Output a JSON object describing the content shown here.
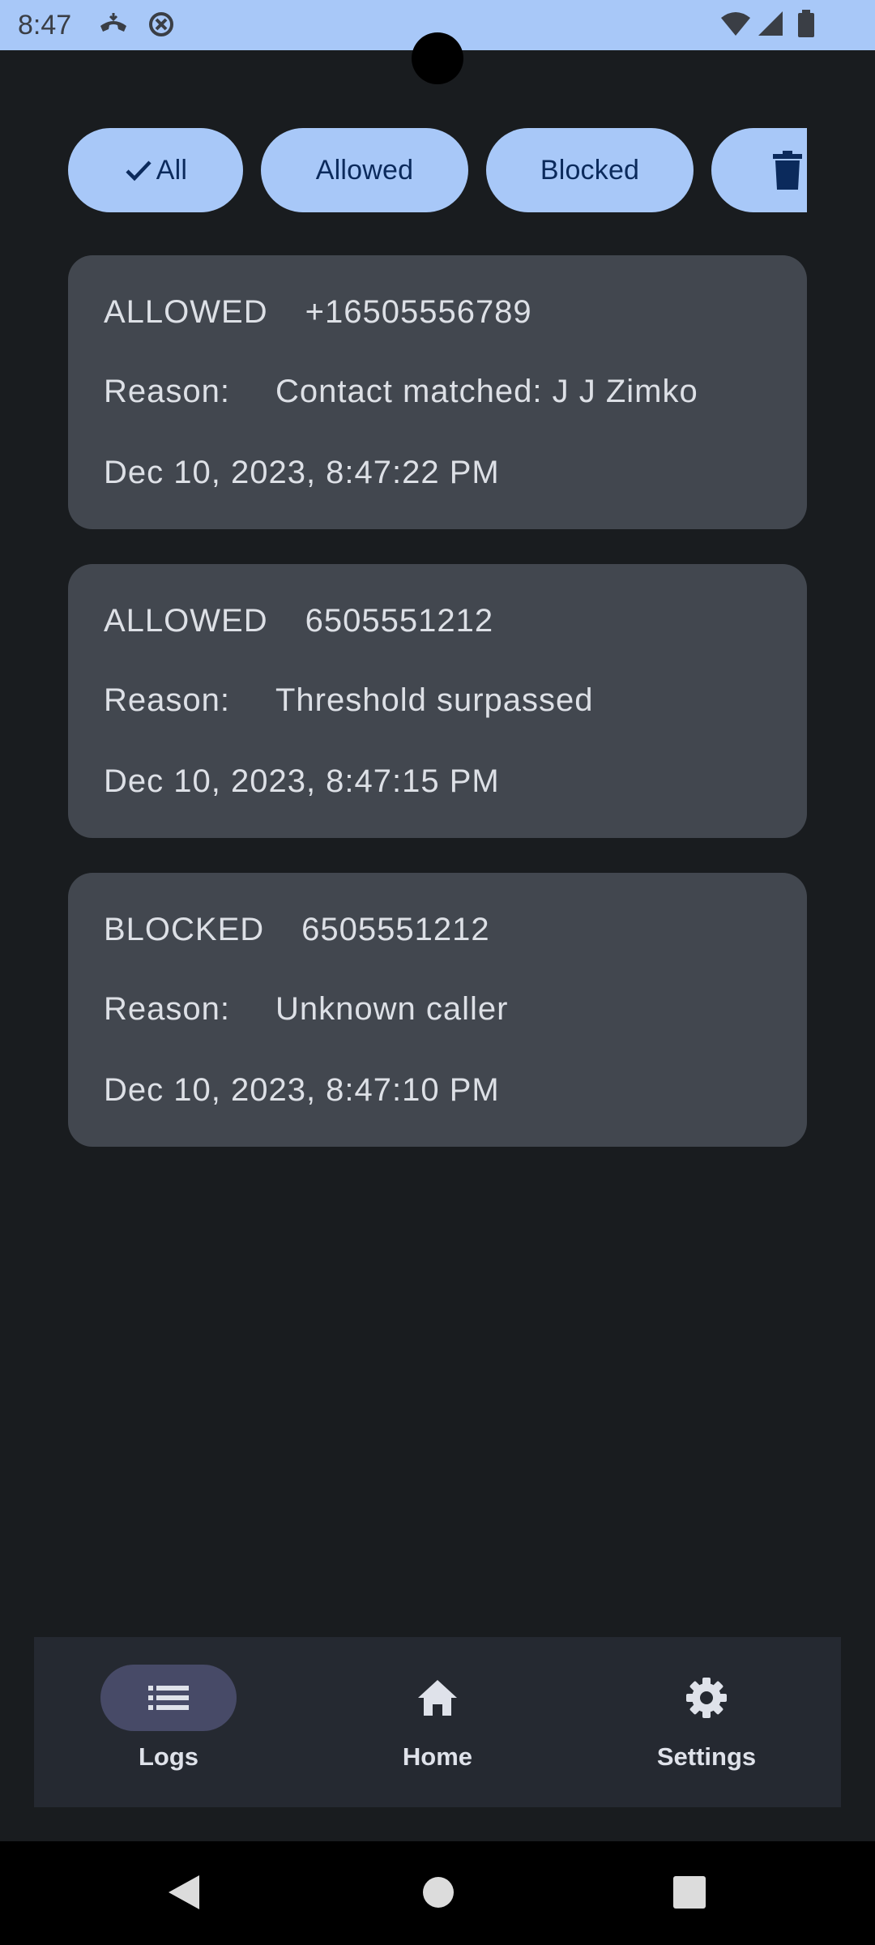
{
  "status_bar": {
    "time": "8:47"
  },
  "filters": [
    {
      "label": "All",
      "selected": true
    },
    {
      "label": "Allowed",
      "selected": false
    },
    {
      "label": "Blocked",
      "selected": false
    }
  ],
  "logs": [
    {
      "status": "ALLOWED",
      "number": "+16505556789",
      "reason_label": "Reason:",
      "reason": "Contact matched: J J Zimko",
      "timestamp": "Dec 10, 2023, 8:47:22 PM"
    },
    {
      "status": "ALLOWED",
      "number": "6505551212",
      "reason_label": "Reason:",
      "reason": "Threshold surpassed",
      "timestamp": "Dec 10, 2023, 8:47:15 PM"
    },
    {
      "status": "BLOCKED",
      "number": "6505551212",
      "reason_label": "Reason:",
      "reason": "Unknown caller",
      "timestamp": "Dec 10, 2023, 8:47:10 PM"
    }
  ],
  "nav": [
    {
      "label": "Logs",
      "icon": "list-icon",
      "active": true
    },
    {
      "label": "Home",
      "icon": "home-icon",
      "active": false
    },
    {
      "label": "Settings",
      "icon": "gear-icon",
      "active": false
    }
  ],
  "colors": {
    "accent": "#a8c8f8",
    "card": "#42474f",
    "background": "#191c1f"
  }
}
